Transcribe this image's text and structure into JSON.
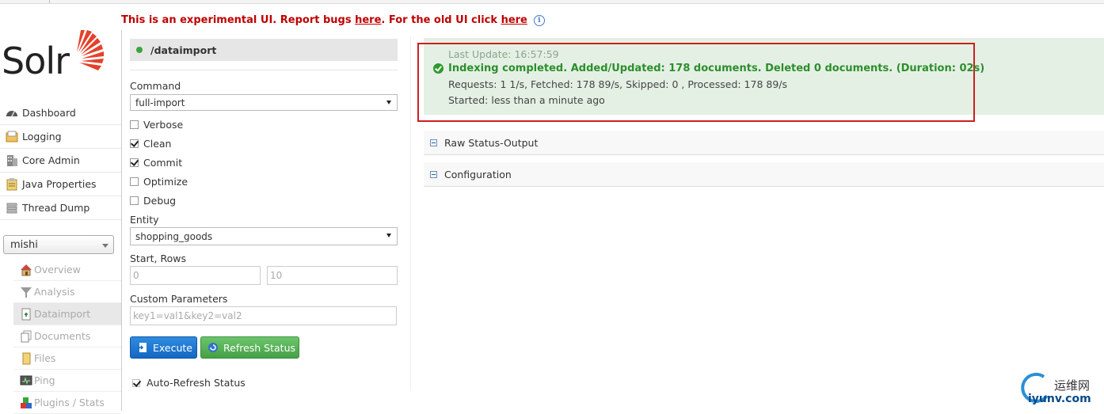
{
  "banner": {
    "prefix": "This is an experimental UI. Report bugs ",
    "bugs_link": "here",
    "middle": ". For the old UI click ",
    "old_link": "here",
    "info_icon": "info-icon"
  },
  "logo": {
    "text": "Solr"
  },
  "nav": {
    "items": [
      {
        "label": "Dashboard",
        "icon": "dashboard-icon"
      },
      {
        "label": "Logging",
        "icon": "logging-icon"
      },
      {
        "label": "Core Admin",
        "icon": "core-admin-icon"
      },
      {
        "label": "Java Properties",
        "icon": "java-properties-icon"
      },
      {
        "label": "Thread Dump",
        "icon": "thread-dump-icon"
      }
    ],
    "core_selected": "mishi",
    "core_items": [
      {
        "label": "Overview",
        "icon": "home-icon"
      },
      {
        "label": "Analysis",
        "icon": "funnel-icon"
      },
      {
        "label": "Dataimport",
        "icon": "dataimport-icon"
      },
      {
        "label": "Documents",
        "icon": "documents-icon"
      },
      {
        "label": "Files",
        "icon": "folder-icon"
      },
      {
        "label": "Ping",
        "icon": "ping-icon"
      },
      {
        "label": "Plugins / Stats",
        "icon": "plugins-icon"
      }
    ]
  },
  "form": {
    "handler": "/dataimport",
    "command_label": "Command",
    "command_value": "full-import",
    "options": [
      {
        "label": "Verbose",
        "checked": false
      },
      {
        "label": "Clean",
        "checked": true
      },
      {
        "label": "Commit",
        "checked": true
      },
      {
        "label": "Optimize",
        "checked": false
      },
      {
        "label": "Debug",
        "checked": false
      }
    ],
    "entity_label": "Entity",
    "entity_value": "shopping_goods",
    "start_rows_label": "Start, Rows",
    "start_placeholder": "0",
    "rows_placeholder": "10",
    "custom_label": "Custom Parameters",
    "custom_placeholder": "key1=val1&key2=val2",
    "execute_label": "Execute",
    "refresh_label": "Refresh Status",
    "auto_refresh_label": "Auto-Refresh Status",
    "auto_refresh_checked": true
  },
  "status": {
    "last_update": "Last Update: 16:57:59",
    "message": "Indexing completed. Added/Updated: 178 documents. Deleted 0 documents. (Duration: 02s)",
    "requests": "Requests: 1 1/s, Fetched: 178 89/s, Skipped: 0 , Processed: 178 89/s",
    "started": "Started: less than a minute ago",
    "colors": {
      "ok": "#2c8f2c",
      "panel": "#e5f0e5",
      "highlight": "#cc1f1f"
    }
  },
  "sections": {
    "raw": "Raw Status-Output",
    "config": "Configuration"
  },
  "watermark": {
    "line1": "运维网",
    "line2": "iyunv.com"
  }
}
